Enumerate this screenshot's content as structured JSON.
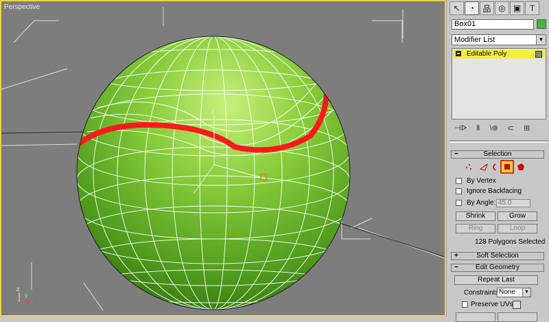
{
  "viewport": {
    "label": "Perspective",
    "axis_x": "x",
    "axis_y": "y",
    "axis_z": "z"
  },
  "tabs": [
    "create-icon",
    "modify-icon",
    "hierarchy-icon",
    "motion-icon",
    "display-icon",
    "utilities-icon"
  ],
  "tab_glyphs": [
    "↖",
    "◔",
    "品",
    "◎",
    "▣",
    "T"
  ],
  "object": {
    "name": "Box01",
    "color": "#4fb43b"
  },
  "modifier_list": {
    "value": "Modifier List",
    "arrow": "▼"
  },
  "stack": {
    "item": "Editable Poly"
  },
  "stack_tools": [
    "⊣ᐅ",
    "Ⅱ",
    "\\⊛",
    "⊂",
    "⊞"
  ],
  "selection": {
    "header": "Selection",
    "sign": "−",
    "by_vertex": "By Vertex",
    "ignore_backfacing": "Ignore Backfacing",
    "by_angle": "By Angle:",
    "angle_value": "45.0",
    "shrink": "Shrink",
    "grow": "Grow",
    "ring": "Ring",
    "loop": "Loop",
    "status": "128 Polygons Selected"
  },
  "soft_selection": {
    "header": "Soft Selection",
    "sign": "+"
  },
  "edit_geometry": {
    "header": "Edit Geometry",
    "sign": "−",
    "repeat_last": "Repeat Last",
    "constraints_label": "Constraints:",
    "constraints_value": "None",
    "preserve_uvs": "Preserve UVs"
  },
  "colors": {
    "viewport_border": "#f2d23a",
    "sphere": "#6ab825",
    "seam": "#ff0000",
    "highlight": "#f6ef3a"
  }
}
